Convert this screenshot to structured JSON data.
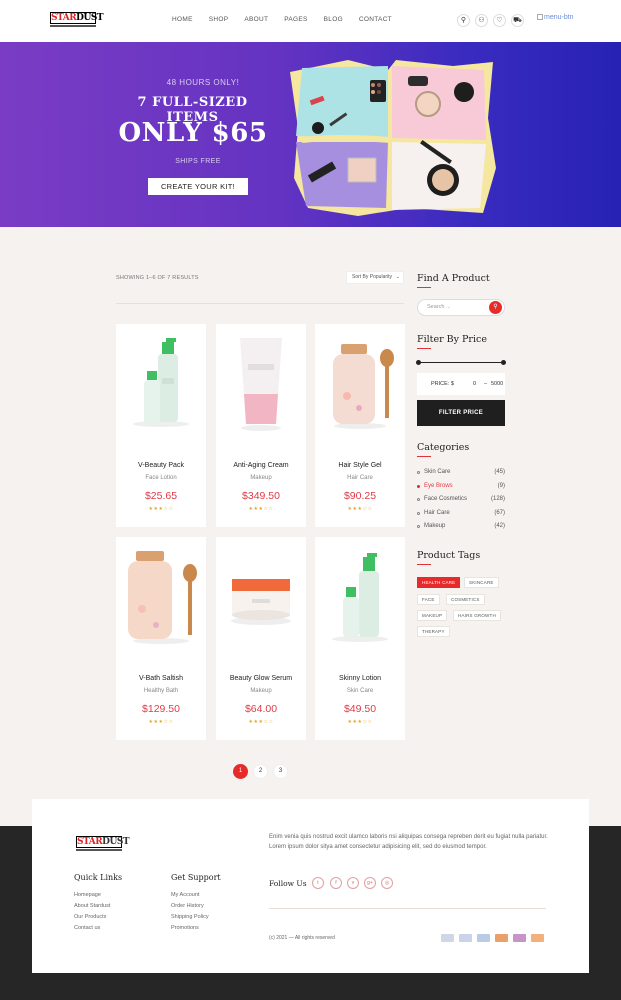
{
  "header": {
    "logo": {
      "text_a": "STAR",
      "text_b": "DUST"
    },
    "nav": [
      "HOME",
      "SHOP",
      "ABOUT",
      "PAGES",
      "BLOG",
      "CONTACT"
    ],
    "menu_alt": "menu-btn"
  },
  "hero": {
    "kicker": "48 HOURS ONLY!",
    "headline": "7 FULL-SIZED ITEMS",
    "price_line": "ONLY $65",
    "shipping": "SHIPS FREE",
    "cta": "CREATE YOUR KIT!"
  },
  "shop": {
    "results": "SHOWING 1–6 OF 7 RESULTS",
    "sort": "Sort By Popularity",
    "products": [
      {
        "name": "V-Beauty Pack",
        "category": "Face Lotion",
        "price": "$25.65",
        "rating": 3
      },
      {
        "name": "Anti-Aging Cream",
        "category": "Makeup",
        "price": "$349.50",
        "rating": 3
      },
      {
        "name": "Hair Style Gel",
        "category": "Hair Care",
        "price": "$90.25",
        "rating": 3
      },
      {
        "name": "V-Bath Saltish",
        "category": "Healthy Bath",
        "price": "$129.50",
        "rating": 3
      },
      {
        "name": "Beauty Glow Serum",
        "category": "Makeup",
        "price": "$64.00",
        "rating": 3
      },
      {
        "name": "Skinny Lotion",
        "category": "Skin Care",
        "price": "$49.50",
        "rating": 3
      }
    ],
    "pagination": [
      "1",
      "2",
      "3"
    ],
    "active_page": "1"
  },
  "sidebar": {
    "find_title": "Find A Product",
    "search_placeholder": "Search ...",
    "price_title": "Filter By Price",
    "price_label": "PRICE: $",
    "price_min": "0",
    "price_max": "5000",
    "filter_btn": "FILTER PRICE",
    "categories_title": "Categories",
    "categories": [
      {
        "name": "Skin Care",
        "count": "(45)"
      },
      {
        "name": "Eye Brows",
        "count": "(9)"
      },
      {
        "name": "Face Cosmetics",
        "count": "(128)"
      },
      {
        "name": "Hair Care",
        "count": "(67)"
      },
      {
        "name": "Makeup",
        "count": "(42)"
      }
    ],
    "active_category": "Eye Brows",
    "tags_title": "Product Tags",
    "tags": [
      "HEALTH CARE",
      "SKINCARE",
      "FACE",
      "COSMETICS",
      "MAKEUP",
      "HAIRS GROWTH",
      "THERAPY"
    ],
    "active_tag": "HEALTH CARE"
  },
  "footer": {
    "about": "Enim venia quis nostrud excit ulamco laboris nsi aliquipas consega repreben derit eu fugiat nulla pariatur. Lorem ipsum dolor sitya amet consectetur adipisicing elit, sed do eiusmod tempor.",
    "quick_title": "Quick Links",
    "quick_links": [
      "Homepage",
      "About Stardust",
      "Our Products",
      "Contact us"
    ],
    "support_title": "Get Support",
    "support_links": [
      "My Account",
      "Order History",
      "Shipping Policy",
      "Promotions"
    ],
    "follow_label": "Follow Us",
    "social": [
      "twitter-icon",
      "facebook-icon",
      "vimeo-icon",
      "google-plus-icon",
      "instagram-icon"
    ],
    "copyright": "(c) 2021 — All rights reserved",
    "payment_colors": [
      "#cfd6e6",
      "#c9d3ea",
      "#b9cbe6",
      "#e9a06b",
      "#c794c9",
      "#f2b07c"
    ]
  },
  "colors": {
    "accent": "#e72a2a",
    "price": "#e13b47",
    "star": "#e0a72a"
  }
}
